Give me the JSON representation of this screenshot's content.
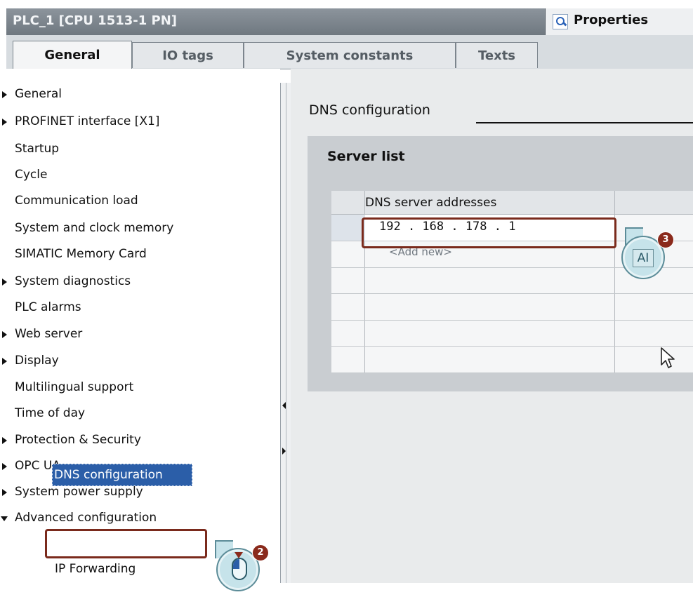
{
  "header": {
    "device_title": "PLC_1 [CPU 1513-1 PN]",
    "properties_label": "Properties"
  },
  "tabs": [
    {
      "label": "General",
      "active": true
    },
    {
      "label": "IO tags",
      "active": false
    },
    {
      "label": "System constants",
      "active": false
    },
    {
      "label": "Texts",
      "active": false
    }
  ],
  "sidebar": {
    "items": [
      {
        "label": "General",
        "expander": "collapsed"
      },
      {
        "label": "PROFINET interface [X1]",
        "expander": "collapsed"
      },
      {
        "label": "Startup",
        "expander": "none"
      },
      {
        "label": "Cycle",
        "expander": "none"
      },
      {
        "label": "Communication load",
        "expander": "none"
      },
      {
        "label": "System and clock memory",
        "expander": "none"
      },
      {
        "label": "SIMATIC Memory Card",
        "expander": "none"
      },
      {
        "label": "System diagnostics",
        "expander": "collapsed"
      },
      {
        "label": "PLC alarms",
        "expander": "none"
      },
      {
        "label": "Web server",
        "expander": "collapsed"
      },
      {
        "label": "Display",
        "expander": "collapsed"
      },
      {
        "label": "Multilingual support",
        "expander": "none"
      },
      {
        "label": "Time of day",
        "expander": "none"
      },
      {
        "label": "Protection & Security",
        "expander": "collapsed"
      },
      {
        "label": "OPC UA",
        "expander": "collapsed"
      },
      {
        "label": "System power supply",
        "expander": "collapsed"
      },
      {
        "label": "Advanced configuration",
        "expander": "expanded"
      }
    ],
    "sub_items": [
      {
        "label": "DNS configuration",
        "selected": true
      },
      {
        "label": "IP Forwarding",
        "selected": false
      }
    ]
  },
  "content": {
    "section_title": "DNS configuration",
    "panel_title": "Server list",
    "grid": {
      "column_header": "DNS server addresses",
      "rows": [
        {
          "ip": "192 . 168 . 178 . 1"
        }
      ],
      "add_new": "<Add new>"
    }
  },
  "callouts": {
    "step_2": "2",
    "step_3": "3",
    "key_label": "AI"
  },
  "colors": {
    "highlight_border": "#7a2a1c",
    "selection": "#2b5ea8",
    "title_bar": "#6f7880"
  }
}
